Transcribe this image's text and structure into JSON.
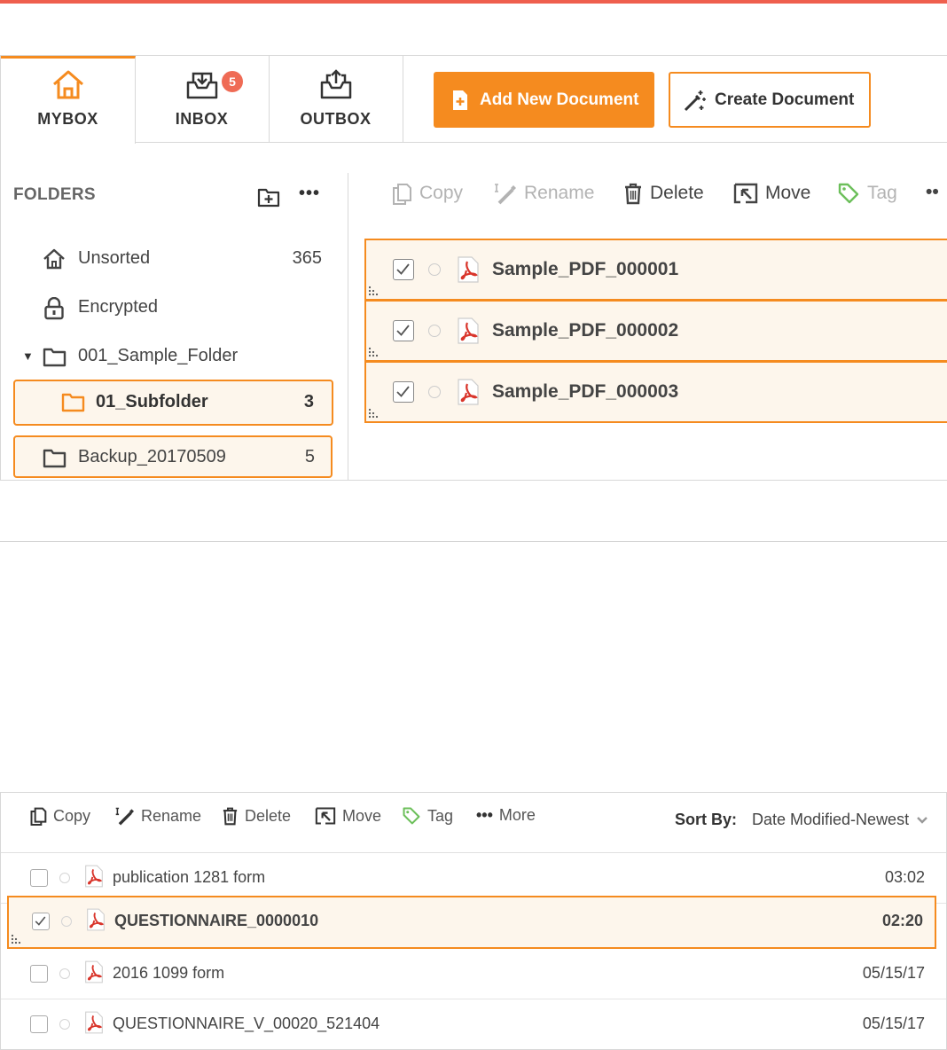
{
  "tabs": [
    {
      "label": "MYBOX",
      "icon": "home-icon",
      "active": true
    },
    {
      "label": "INBOX",
      "icon": "inbox-download-icon",
      "badge": "5"
    },
    {
      "label": "OUTBOX",
      "icon": "outbox-upload-icon"
    }
  ],
  "actions": {
    "add_new_document": "Add New Document",
    "create_document": "Create Document"
  },
  "folders": {
    "header": "FOLDERS",
    "more": "•••",
    "items": [
      {
        "name": "Unsorted",
        "icon": "home-icon",
        "count": "365"
      },
      {
        "name": "Encrypted",
        "icon": "lock-icon",
        "count": ""
      },
      {
        "name": "001_Sample_Folder",
        "icon": "folder-icon",
        "count": "",
        "expanded": true
      },
      {
        "name": "01_Subfolder",
        "icon": "folder-icon",
        "count": "3",
        "selected": true
      },
      {
        "name": "Backup_20170509",
        "icon": "folder-icon",
        "count": "5"
      }
    ]
  },
  "toolbar_top": {
    "copy": "Copy",
    "rename": "Rename",
    "delete": "Delete",
    "move": "Move",
    "tag": "Tag",
    "more": "••"
  },
  "files_top": [
    {
      "name": "Sample_PDF_000001",
      "checked": true
    },
    {
      "name": "Sample_PDF_000002",
      "checked": true
    },
    {
      "name": "Sample_PDF_000003",
      "checked": true
    }
  ],
  "toolbar_bottom": {
    "copy": "Copy",
    "rename": "Rename",
    "delete": "Delete",
    "move": "Move",
    "tag": "Tag",
    "more": "More",
    "more_dots": "•••",
    "sort_label": "Sort By:",
    "sort_value": "Date Modified-Newest"
  },
  "files_bottom": [
    {
      "name": "publication 1281 form",
      "date": "03:02",
      "checked": false
    },
    {
      "name": "QUESTIONNAIRE_0000010",
      "date": "02:20",
      "checked": true
    },
    {
      "name": "2016 1099 form",
      "date": "05/15/17",
      "checked": false
    },
    {
      "name": "QUESTIONNAIRE_V_00020_521404",
      "date": "05/15/17",
      "checked": false
    }
  ],
  "colors": {
    "accent": "#f58b1f",
    "topbar": "#ef5f4e",
    "badge": "#ef6b55",
    "pdf": "#d9352b",
    "tag": "#6cbf5a"
  }
}
